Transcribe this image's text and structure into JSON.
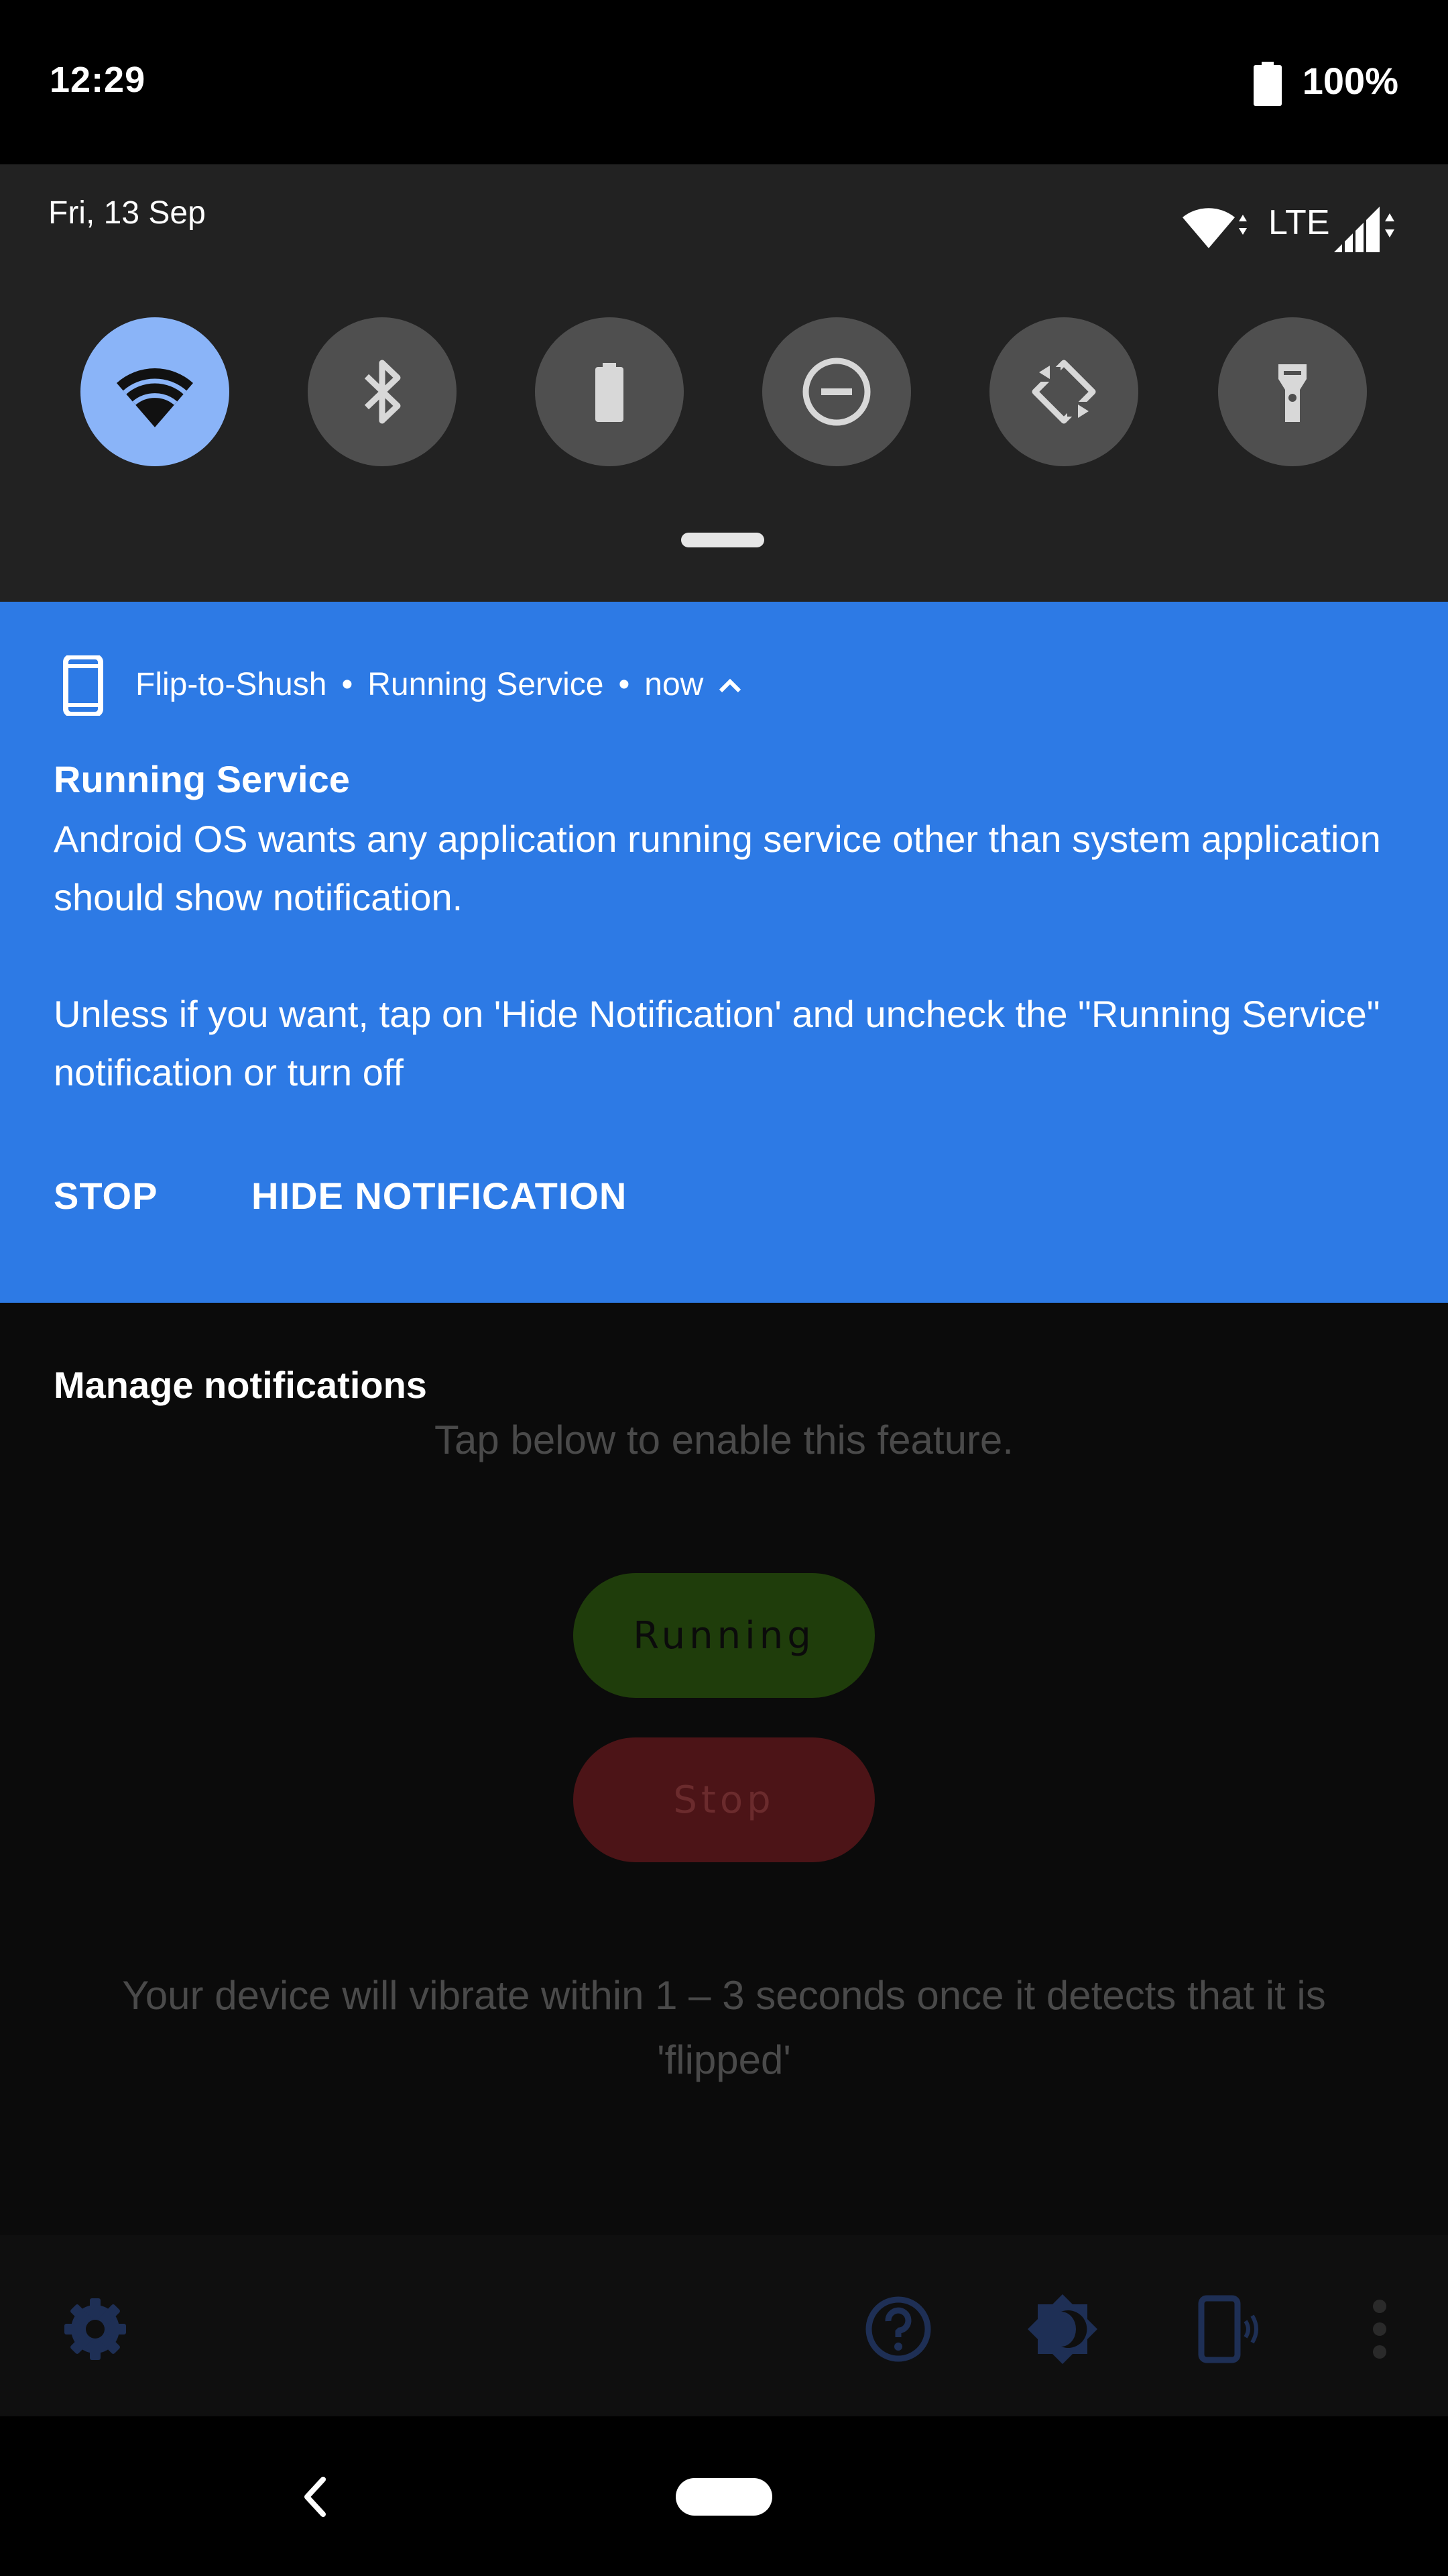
{
  "status_bar": {
    "time": "12:29",
    "battery_percent": "100%"
  },
  "quick_settings": {
    "date": "Fri, 13 Sep",
    "network_type": "LTE",
    "tiles": [
      {
        "icon": "wifi-icon",
        "state": "on"
      },
      {
        "icon": "bluetooth-icon",
        "state": "off"
      },
      {
        "icon": "battery-saver-icon",
        "state": "off"
      },
      {
        "icon": "do-not-disturb-icon",
        "state": "off"
      },
      {
        "icon": "auto-rotate-icon",
        "state": "off"
      },
      {
        "icon": "flashlight-icon",
        "state": "off"
      }
    ],
    "colors": {
      "panel": "#222222",
      "tile_on": "#8ab4f8",
      "tile_off": "#4f4f4f"
    }
  },
  "notification": {
    "app_name": "Flip-to-Shush",
    "channel": "Running Service",
    "time": "now",
    "separator": "•",
    "title": "Running Service",
    "body": "Android OS wants any application running service other than system application should show notification.\n\nUnless if you want, tap on 'Hide Notification' and uncheck the \"Running Service\" notification or turn off",
    "actions": {
      "stop": "STOP",
      "hide": "HIDE NOTIFICATION"
    },
    "color": "#2d7ae5"
  },
  "manage_notifications": "Manage notifications",
  "app": {
    "instruction": "Tap below to enable this feature.",
    "running_label": "Running",
    "stop_label": "Stop",
    "note": "Your device will vibrate within 1 – 3 seconds once it detects that it is 'flipped'",
    "colors": {
      "running": "#1f3d0b",
      "stop": "#4c1417"
    }
  },
  "toolbar": {
    "icons": [
      "settings-icon",
      "help-icon",
      "theme-icon",
      "vibrate-phone-icon",
      "more-vert-icon"
    ],
    "icon_color": "#1e2f55"
  },
  "navigation": {
    "icons": [
      "back-icon",
      "home-pill"
    ]
  }
}
